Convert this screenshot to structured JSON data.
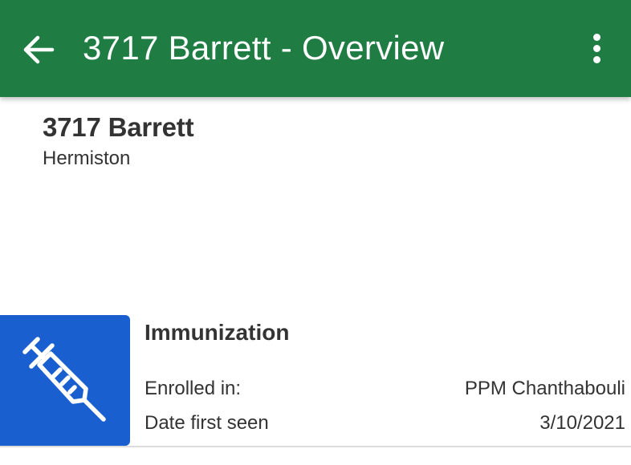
{
  "colors": {
    "app_bar": "#1F7D43",
    "program_tile": "#1A5FCF",
    "text_primary": "#333333"
  },
  "app_bar": {
    "title": "3717 Barrett - Overview",
    "back_icon": "arrow-left-icon",
    "menu_icon": "more-vertical-icon"
  },
  "header": {
    "name": "3717 Barrett",
    "location": "Hermiston"
  },
  "program": {
    "icon": "syringe-icon",
    "title": "Immunization",
    "rows": [
      {
        "label": "Enrolled in:",
        "value": "PPM Chanthabouli"
      },
      {
        "label": "Date first seen",
        "value": "3/10/2021"
      }
    ]
  }
}
